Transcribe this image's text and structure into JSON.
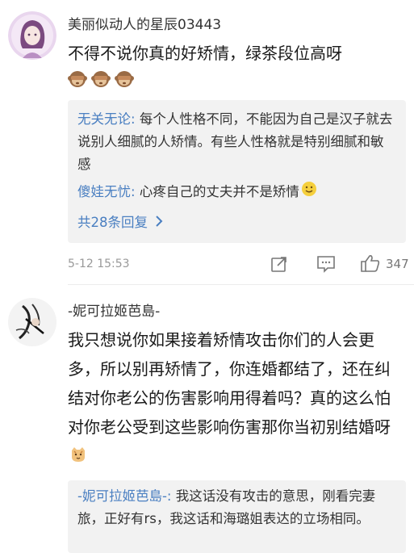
{
  "comments": [
    {
      "username": "美丽似动人的星辰03443",
      "text": "不得不说你真的好矫情，绿茶段位高呀",
      "replies": [
        {
          "author": "无关无论",
          "sep": ": ",
          "text": "每个人性格不同，不能因为自己是汉子就去说别人细腻的人矫情。有些人性格就是特别细腻和敏感"
        },
        {
          "author": "傻娃无忧",
          "sep": ": ",
          "text": "心疼自己的丈夫并不是矫情"
        }
      ],
      "more_replies": "共28条回复",
      "time": "5-12 15:53",
      "likes": "347"
    },
    {
      "username": "-妮可拉姬芭島-",
      "text": "我只想说你如果接着矫情攻击你们的人会更多，所以别再矫情了，你连婚都结了，还在纠结对你老公的伤害影响用得着吗？真的这么怕对你老公受到这些影响伤害那你当初别结婚呀",
      "replies": [
        {
          "author": "-妮可拉姬芭島-",
          "sep": ": ",
          "text": "我这话没有攻击的意思，刚看完妻旅，正好有rs，我这话和海璐姐表达的立场相同。"
        }
      ]
    }
  ],
  "icons": {
    "emoji_monkey": "see-no-evil-monkey",
    "emoji_smile": "smile",
    "emoji_cat": "cat-face",
    "share": "share-icon",
    "comment": "comment-icon",
    "like": "thumbs-up-icon"
  },
  "colors": {
    "reply_author": "#4a7fc1",
    "reply_bg": "#f2f2f2",
    "meta": "#999999"
  }
}
